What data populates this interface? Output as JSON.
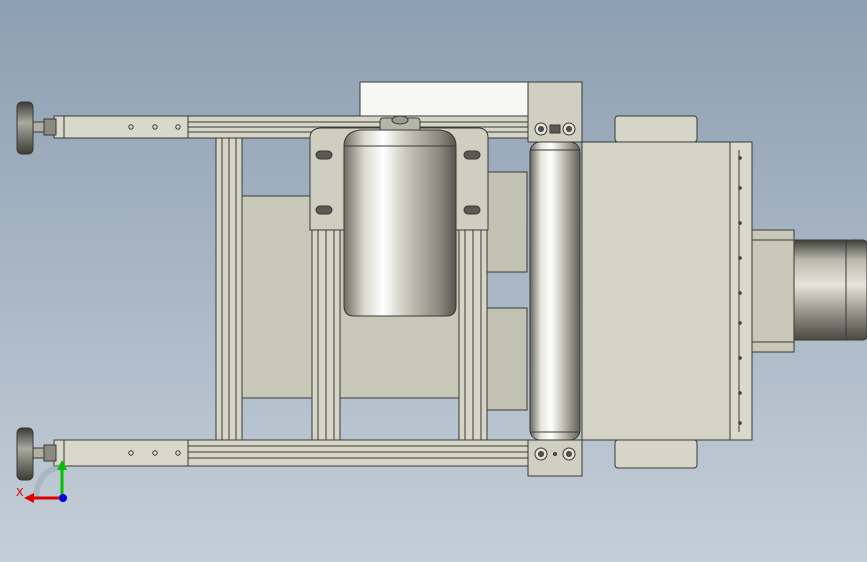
{
  "viewport": {
    "background_top": "#8d9fb2",
    "background_bottom": "#c4ced8"
  },
  "model": {
    "frame_color": "#d4d4c6",
    "frame_edge": "#3a3a36",
    "panel_color": "#c8c8b8",
    "roller_highlight": "#ffffff",
    "roller_shadow": "#7b7b70"
  },
  "triad": {
    "x_label": "X",
    "x_color": "#e00000",
    "y_color": "#00c000",
    "z_color": "#0000e0"
  }
}
